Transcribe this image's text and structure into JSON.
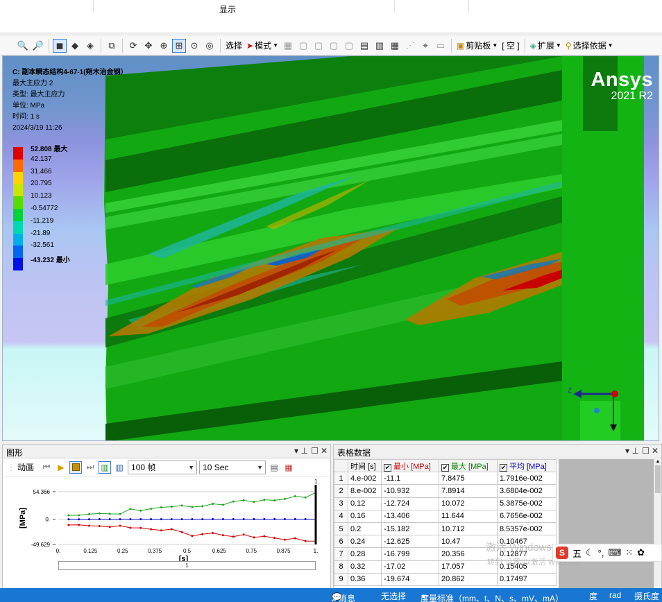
{
  "ribbon": {
    "group_label": "显示"
  },
  "toolbar": {
    "select": "选择",
    "mode": "模式",
    "clipboard": "剪贴板",
    "empty": "[ 空 ]",
    "extend": "扩展",
    "select_by": "选择依据"
  },
  "viewport": {
    "info": {
      "title": "C: 副本瞬态结构4-67-1(朔木治金钢）",
      "result": "最大主应力 2",
      "type": "类型: 最大主应力",
      "unit": "单位: MPa",
      "time": "时间: 1 s",
      "date": "2024/3/19 11:26"
    },
    "legend": [
      {
        "label": "52.808 最大",
        "color": "#e00000"
      },
      {
        "label": "42.137",
        "color": "#ff6a00"
      },
      {
        "label": "31.466",
        "color": "#ffd400"
      },
      {
        "label": "20.795",
        "color": "#c8e600"
      },
      {
        "label": "10.123",
        "color": "#5adc00"
      },
      {
        "label": "-0.54772",
        "color": "#00d33a"
      },
      {
        "label": "-11.219",
        "color": "#00d8b4"
      },
      {
        "label": "-21.89",
        "color": "#00b0e8"
      },
      {
        "label": "-32.561",
        "color": "#0066f0"
      },
      {
        "label": "-43.232 最小",
        "color": "#0010e8"
      }
    ],
    "logo": {
      "brand": "Ansys",
      "version": "2021 R2"
    },
    "triad_z": "Z"
  },
  "graph_panel": {
    "title": "图形",
    "animation_label": "动画",
    "frames": "100 帧",
    "duration": "10 Sec",
    "progress_label": "1",
    "chart": {
      "ylabel": "[MPa]",
      "xlabel": "[s]",
      "y_ticks": [
        "54.366",
        "0.",
        "-49.629"
      ],
      "x_ticks": [
        "0.",
        "0.125",
        "0.25",
        "0.375",
        "0.5",
        "0.625",
        "0.75",
        "0.875",
        "1."
      ],
      "cursor_label": "1."
    }
  },
  "chart_data": {
    "type": "line",
    "xlabel": "[s]",
    "ylabel": "[MPa]",
    "ylim": [
      -49.629,
      54.366
    ],
    "xlim": [
      0,
      1
    ],
    "series": [
      {
        "color": "#21a321",
        "points": [
          [
            0.04,
            7.85
          ],
          [
            0.08,
            7.89
          ],
          [
            0.12,
            10.07
          ],
          [
            0.16,
            11.64
          ],
          [
            0.2,
            10.71
          ],
          [
            0.24,
            10.47
          ],
          [
            0.28,
            20.36
          ],
          [
            0.32,
            17.06
          ],
          [
            0.36,
            20.86
          ],
          [
            0.4,
            23.5
          ],
          [
            0.44,
            24.8
          ],
          [
            0.48,
            27.0
          ],
          [
            0.52,
            24.2
          ],
          [
            0.56,
            25.6
          ],
          [
            0.6,
            30.4
          ],
          [
            0.64,
            28.6
          ],
          [
            0.68,
            35.0
          ],
          [
            0.72,
            37.6
          ],
          [
            0.76,
            34.2
          ],
          [
            0.8,
            38.4
          ],
          [
            0.84,
            37.3
          ],
          [
            0.88,
            40.1
          ],
          [
            0.92,
            45.4
          ],
          [
            0.96,
            43.0
          ],
          [
            1.0,
            52.8
          ]
        ]
      },
      {
        "color": "#0000cc",
        "points": [
          [
            0.04,
            0.018
          ],
          [
            0.08,
            0.037
          ],
          [
            0.12,
            0.054
          ],
          [
            0.16,
            0.068
          ],
          [
            0.2,
            0.085
          ],
          [
            0.24,
            0.105
          ],
          [
            0.28,
            0.129
          ],
          [
            0.32,
            0.154
          ],
          [
            0.36,
            0.175
          ],
          [
            0.4,
            0.19
          ],
          [
            0.44,
            0.2
          ],
          [
            0.48,
            0.21
          ],
          [
            0.52,
            0.22
          ],
          [
            0.56,
            0.23
          ],
          [
            0.6,
            0.24
          ],
          [
            0.64,
            0.25
          ],
          [
            0.68,
            0.26
          ],
          [
            0.72,
            0.27
          ],
          [
            0.76,
            0.28
          ],
          [
            0.8,
            0.29
          ],
          [
            0.84,
            0.3
          ],
          [
            0.88,
            0.31
          ],
          [
            0.92,
            0.32
          ],
          [
            0.96,
            0.33
          ],
          [
            1.0,
            0.34
          ]
        ]
      },
      {
        "color": "#cc0000",
        "points": [
          [
            0.04,
            -11.1
          ],
          [
            0.08,
            -10.93
          ],
          [
            0.12,
            -12.72
          ],
          [
            0.16,
            -13.41
          ],
          [
            0.2,
            -15.18
          ],
          [
            0.24,
            -12.63
          ],
          [
            0.28,
            -16.8
          ],
          [
            0.32,
            -17.02
          ],
          [
            0.36,
            -19.67
          ],
          [
            0.4,
            -22.0
          ],
          [
            0.44,
            -19.5
          ],
          [
            0.48,
            -25.3
          ],
          [
            0.52,
            -32.8
          ],
          [
            0.56,
            -29.4
          ],
          [
            0.6,
            -27.0
          ],
          [
            0.64,
            -31.5
          ],
          [
            0.68,
            -34.2
          ],
          [
            0.72,
            -30.2
          ],
          [
            0.76,
            -35.7
          ],
          [
            0.8,
            -33.6
          ],
          [
            0.84,
            -36.8
          ],
          [
            0.88,
            -40.3
          ],
          [
            0.92,
            -37.5
          ],
          [
            0.96,
            -43.0
          ],
          [
            1.0,
            -43.2
          ]
        ]
      }
    ]
  },
  "table_panel": {
    "title": "表格数据",
    "headers": [
      "时间 [s]",
      "最小 [MPa]",
      "最大 [MPa]",
      "平均 [MPa]"
    ],
    "header_colors": [
      "#000000",
      "#cc0000",
      "#008000",
      "#0000cc"
    ],
    "rows": [
      [
        "1",
        "4.e-002",
        "-11.1",
        "7.8475",
        "1.7916e-002"
      ],
      [
        "2",
        "8.e-002",
        "-10.932",
        "7.8914",
        "3.6804e-002"
      ],
      [
        "3",
        "0.12",
        "-12.724",
        "10.072",
        "5.3875e-002"
      ],
      [
        "4",
        "0.16",
        "-13.406",
        "11.644",
        "6.7656e-002"
      ],
      [
        "5",
        "0.2",
        "-15.182",
        "10.712",
        "8.5357e-002"
      ],
      [
        "6",
        "0.24",
        "-12.625",
        "10.47",
        "0.10467"
      ],
      [
        "7",
        "0.28",
        "-16.799",
        "20.356",
        "0.12877"
      ],
      [
        "8",
        "0.32",
        "-17.02",
        "17.057",
        "0.15405"
      ],
      [
        "9",
        "0.36",
        "-19.674",
        "20.862",
        "0.17497"
      ]
    ]
  },
  "ime": {
    "mode": "五"
  },
  "watermark": {
    "line1": "激活 Windows",
    "line2": "转到\"设置\"以激活 Windows"
  },
  "statusbar": {
    "messages": "2 消息",
    "selection": "无选择",
    "units": "度量标准（mm、t、N、s、mV、mA）",
    "angle": "度",
    "rad": "rad",
    "temp": "摄氏度"
  }
}
